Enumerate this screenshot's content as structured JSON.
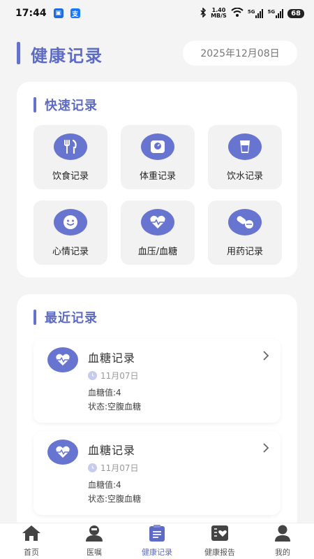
{
  "status_bar": {
    "time": "17:44",
    "speed_value": "1.40",
    "speed_unit": "MB/S",
    "net1": "5G",
    "net2": "5G",
    "battery": "68"
  },
  "header": {
    "title": "健康记录",
    "date": "2025年12月08日"
  },
  "quick": {
    "title": "快速记录",
    "items": [
      {
        "label": "饮食记录",
        "icon": "utensils-icon"
      },
      {
        "label": "体重记录",
        "icon": "scale-icon"
      },
      {
        "label": "饮水记录",
        "icon": "water-cup-icon"
      },
      {
        "label": "心情记录",
        "icon": "smile-icon"
      },
      {
        "label": "血压/血糖",
        "icon": "heart-pulse-icon"
      },
      {
        "label": "用药记录",
        "icon": "pill-icon"
      }
    ]
  },
  "recent": {
    "title": "最近记录",
    "records": [
      {
        "title": "血糖记录",
        "date": "11月07日",
        "value": "血糖值:4",
        "state": "状态:空腹血糖"
      },
      {
        "title": "血糖记录",
        "date": "11月07日",
        "value": "血糖值:4",
        "state": "状态:空腹血糖"
      }
    ]
  },
  "nav": {
    "items": [
      {
        "label": "首页",
        "icon": "home-icon"
      },
      {
        "label": "医嘱",
        "icon": "doctor-icon"
      },
      {
        "label": "健康记录",
        "icon": "clipboard-icon"
      },
      {
        "label": "健康报告",
        "icon": "report-icon"
      },
      {
        "label": "我的",
        "icon": "user-icon"
      }
    ],
    "active": "健康记录"
  },
  "colors": {
    "accent": "#5e6bc4",
    "icon_bg": "#6875d0",
    "background": "#f4f4f4"
  }
}
